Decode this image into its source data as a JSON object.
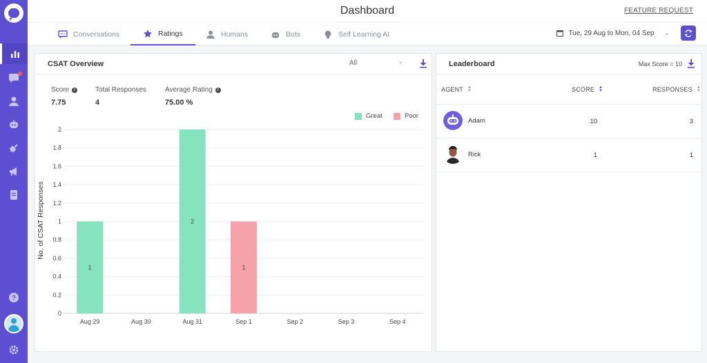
{
  "header": {
    "title": "Dashboard",
    "feature_request": "FEATURE REQUEST"
  },
  "tabs": [
    {
      "label": "Conversations",
      "icon": "chat-icon",
      "active": false
    },
    {
      "label": "Ratings",
      "icon": "star-icon",
      "active": true
    },
    {
      "label": "Humans",
      "icon": "user-icon",
      "active": false
    },
    {
      "label": "Bots",
      "icon": "bot-icon",
      "active": false
    },
    {
      "label": "Self Learning AI",
      "icon": "bulb-icon",
      "active": false
    }
  ],
  "date_range": "Tue, 29 Aug to Mon, 04 Sep",
  "colors": {
    "accent": "#5c4fd1",
    "great": "#86e3bf",
    "poor": "#f6a2ab"
  },
  "csat": {
    "title": "CSAT Overview",
    "filter": "All",
    "stats": [
      {
        "label": "Score",
        "value": "7.75",
        "info": true
      },
      {
        "label": "Total Responses",
        "value": "4",
        "info": false
      },
      {
        "label": "Average Rating",
        "value": "75.00 %",
        "info": true
      }
    ],
    "legend": [
      {
        "name": "Great",
        "color": "#86e3bf"
      },
      {
        "name": "Poor",
        "color": "#f6a2ab"
      }
    ]
  },
  "chart_data": {
    "type": "bar",
    "categories": [
      "Aug 29",
      "Aug 30",
      "Aug 31",
      "Sep 1",
      "Sep 2",
      "Sep 3",
      "Sep 4"
    ],
    "series": [
      {
        "name": "Great",
        "values": [
          1,
          0,
          2,
          0,
          0,
          0,
          0
        ]
      },
      {
        "name": "Poor",
        "values": [
          0,
          0,
          0,
          1,
          0,
          0,
          0
        ]
      }
    ],
    "ylabel": "No. of CSAT Responses",
    "ylim": [
      0,
      2
    ],
    "yticks": [
      "0",
      "0.2",
      "0.4",
      "0.6",
      "0.8",
      "1",
      "1.2",
      "1.4",
      "1.6",
      "1.8",
      "2"
    ],
    "grid": true,
    "legend_position": "top-right"
  },
  "leaderboard": {
    "title": "Leaderboard",
    "max_score": "Max Score = 10",
    "columns": {
      "agent": "AGENT",
      "score": "SCORE",
      "responses": "RESPONSES"
    },
    "rows": [
      {
        "name": "Adam",
        "score": "10",
        "responses": "3",
        "avatar": "bot-avatar"
      },
      {
        "name": "Rick",
        "score": "1",
        "responses": "1",
        "avatar": "person-avatar"
      }
    ]
  }
}
